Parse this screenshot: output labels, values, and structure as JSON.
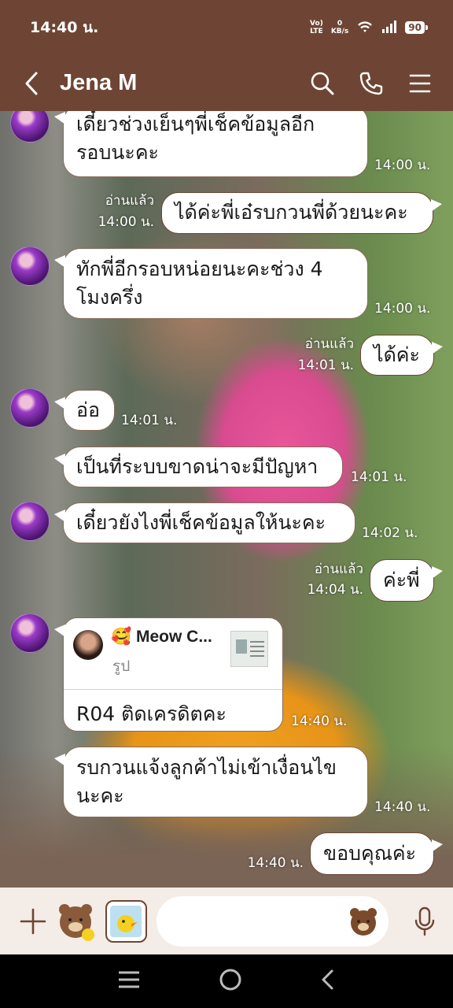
{
  "status": {
    "time": "14:40 น.",
    "net_top": "Vo)",
    "net_bottom": "LTE",
    "speed_top": "0",
    "speed_bottom": "KB/s",
    "battery": "90"
  },
  "header": {
    "title": "Jena M"
  },
  "messages": [
    {
      "text1": "เดี๋ยวช่วงเย็นๆพี่เช็คข้อมูลอีก",
      "text2": "รอบนะคะ",
      "time": "14:00 น."
    },
    {
      "text": "ได้ค่ะพี่เอ๋รบกวนพี่ด้วยนะคะ",
      "read": "อ่านแล้ว",
      "time": "14:00 น."
    },
    {
      "text1": "ทักพี่อีกรอบหน่อยนะคะช่วง 4",
      "text2": "โมงครึ่ง",
      "time": "14:00 น."
    },
    {
      "text": "ได้ค่ะ",
      "read": "อ่านแล้ว",
      "time": "14:01 น."
    },
    {
      "text": "อ่อ",
      "time": "14:01 น."
    },
    {
      "text": "เป็นที่ระบบขาดน่าจะมีปัญหา",
      "time": "14:01 น."
    },
    {
      "text": "เดี๋ยวยังไงพี่เช็คข้อมูลให้นะคะ",
      "time": "14:02 น."
    },
    {
      "text": "ค่ะพี่",
      "read": "อ่านแล้ว",
      "time": "14:04 น."
    },
    {
      "reply_emoji": "🥰",
      "reply_name": "Meow C...",
      "reply_sub": "รูป",
      "text": "R04 ติดเครดิตคะ",
      "time": "14:40 น."
    },
    {
      "text1": "รบกวนแจ้งลูกค้าไม่เข้าเงื่อนไข",
      "text2": "นะคะ",
      "time": "14:40 น."
    },
    {
      "text": "ขอบคุณค่ะ",
      "time": "14:40 น."
    }
  ]
}
